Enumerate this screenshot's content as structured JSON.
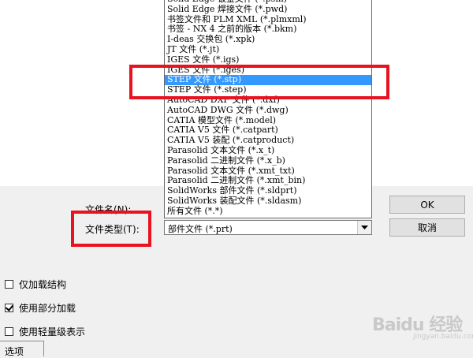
{
  "file_types": {
    "items": [
      "Solid Edge 钣金文件 (*.psm)",
      "Solid Edge 焊接文件 (*.pwd)",
      "书签文件和 PLM XML (*.plmxml)",
      "书签 - NX 4 之前的版本 (*.bkm)",
      "I-deas 交换包 (*.xpk)",
      "JT 文件 (*.jt)",
      "IGES 文件 (*.igs)",
      "IGES 文件 (*.iges)",
      "STEP 文件 (*.stp)",
      "STEP 文件 (*.step)",
      "AutoCAD DXF 文件 (*.dxf)",
      "AutoCAD DWG 文件 (*.dwg)",
      "CATIA 模型文件 (*.model)",
      "CATIA V5 文件 (*.catpart)",
      "CATIA V5 装配 (*.catproduct)",
      "Parasolid 文本文件 (*.x_t)",
      "Parasolid 二进制文件 (*.x_b)",
      "Parasolid 文本文件 (*.xmt_txt)",
      "Parasolid 二进制文件 (*.xmt_bin)",
      "SolidWorks 部件文件 (*.sldprt)",
      "SolidWorks 装配文件 (*.sldasm)",
      "所有文件 (*.*)"
    ],
    "selected_index": 8,
    "selection_color": "#3399ff"
  },
  "form": {
    "filename_label": "文件名(N):",
    "filetype_label": "文件类型(T):",
    "filetype_value": "部件文件 (*.prt)"
  },
  "buttons": {
    "ok": "OK",
    "cancel": "取消"
  },
  "options": [
    {
      "label": "仅加载结构",
      "checked": false
    },
    {
      "label": "使用部分加载",
      "checked": true
    },
    {
      "label": "使用轻量级表示",
      "checked": false
    }
  ],
  "options_tab_label": "选项",
  "highlight_color": "#e8131f",
  "watermark": {
    "brand": "Baidu 经验",
    "sub": "jingyan.baidu.com"
  }
}
